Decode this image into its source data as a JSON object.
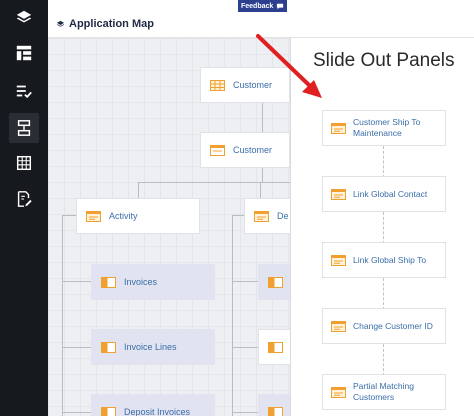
{
  "header": {
    "title": "Application Map",
    "feedback_label": "Feedback"
  },
  "sidebar": {
    "items": [
      {
        "name": "layers",
        "icon": "layers-icon"
      },
      {
        "name": "layout",
        "icon": "layout-icon"
      },
      {
        "name": "list-check",
        "icon": "list-check-icon"
      },
      {
        "name": "flow",
        "icon": "flow-icon"
      },
      {
        "name": "table",
        "icon": "table-icon"
      },
      {
        "name": "document-edit",
        "icon": "document-edit-icon"
      }
    ]
  },
  "map": {
    "nodes": {
      "customer_top": "Customer",
      "customer_form": "Customer",
      "activity": "Activity",
      "partial": "De",
      "invoices": "Invoices",
      "invoice_lines": "Invoice Lines",
      "deposit_invoices": "Deposit Invoices"
    }
  },
  "panel": {
    "title": "Slide Out Panels",
    "items": [
      "Customer Ship To Maintenance",
      "Link Global Contact",
      "Link Global Ship To",
      "Change Customer ID",
      "Partial Matching Customers"
    ]
  },
  "colors": {
    "rail": "#16191d",
    "node_text": "#3a6ea8",
    "child_bg": "#e2e3f1",
    "icon_orange": "#f0a030",
    "arrow": "#e02020",
    "feedback_bg": "#2d3f8f"
  }
}
